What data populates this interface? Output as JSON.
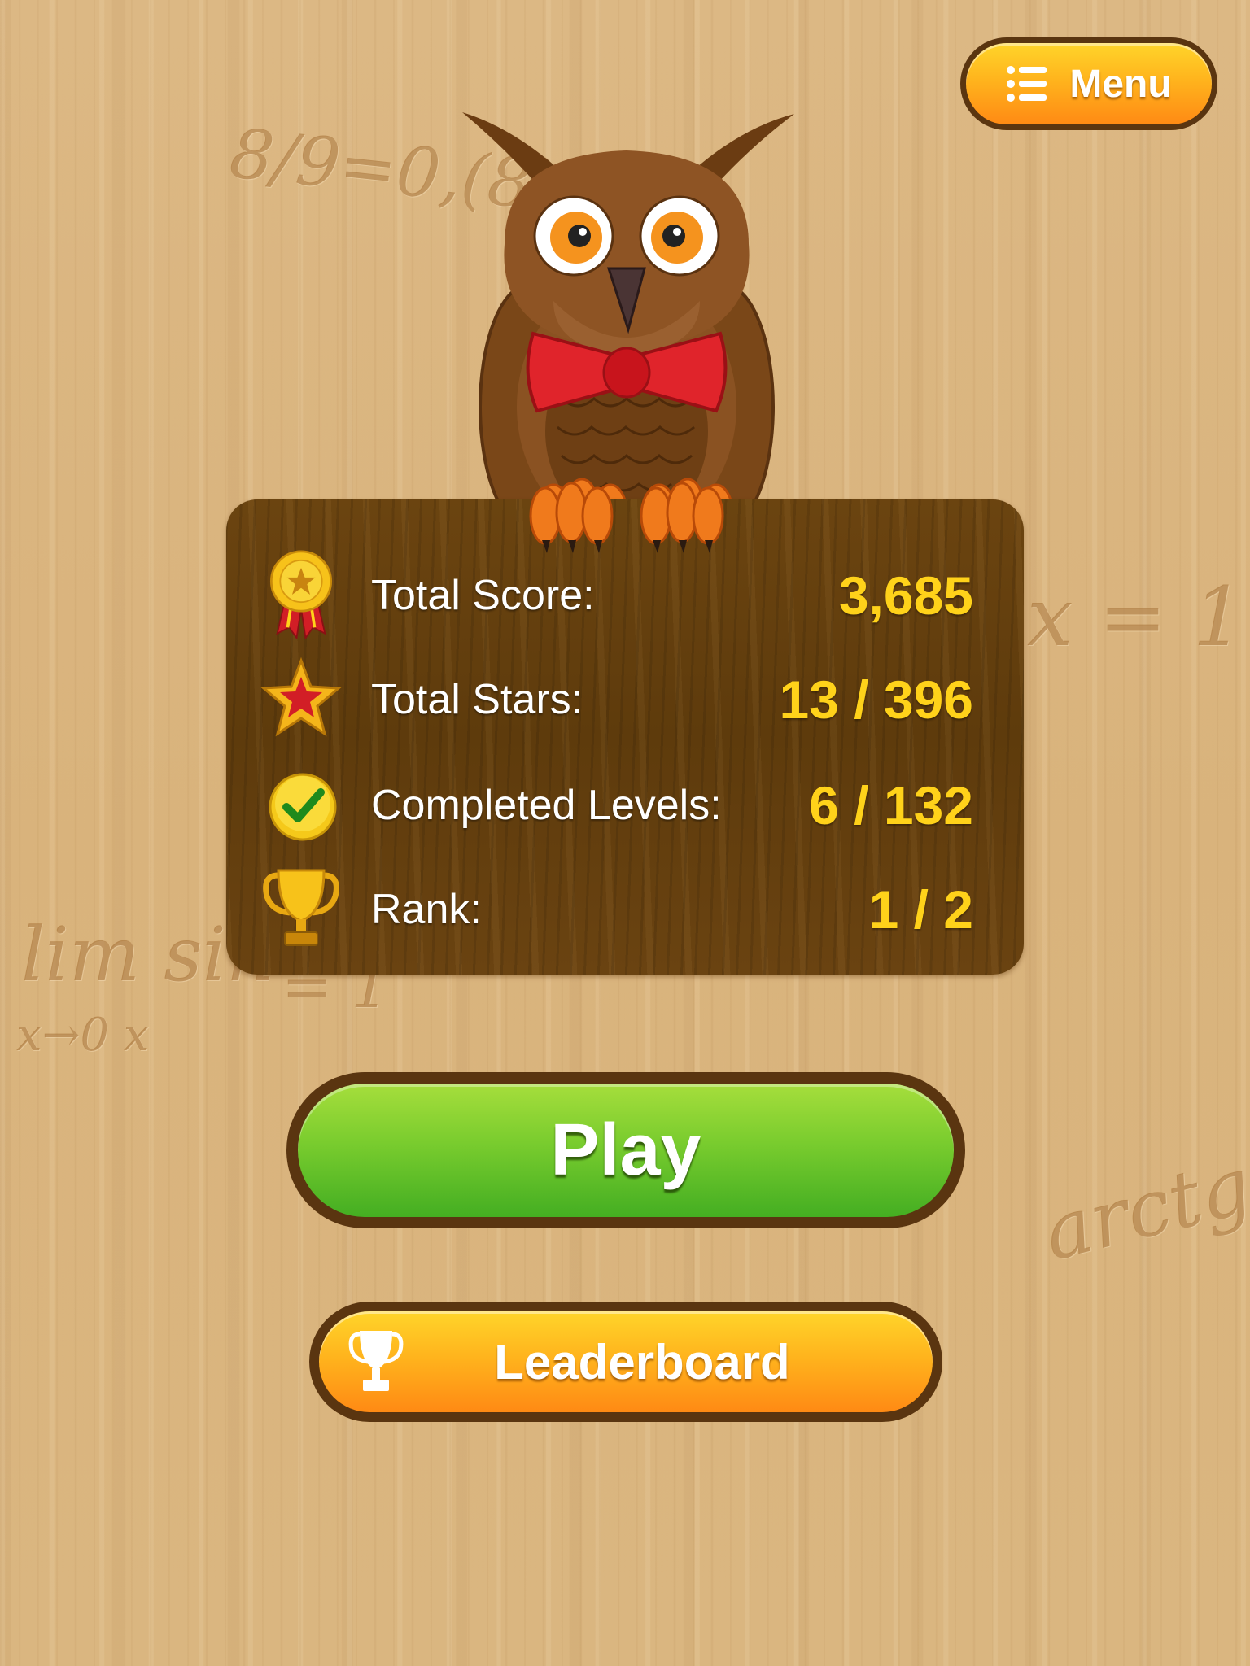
{
  "background": {
    "scribbles": [
      "8/9=0,(8)",
      "x = 1",
      "lim sin",
      "x→0  x",
      "= 1",
      "arctg x"
    ]
  },
  "menu": {
    "label": "Menu",
    "icon": "list-icon"
  },
  "mascot": {
    "icon": "owl-bowtie"
  },
  "stats": {
    "total_score": {
      "label": "Total Score:",
      "value": "3,685",
      "icon": "medal-icon"
    },
    "total_stars": {
      "label": "Total Stars:",
      "value": "13 / 396",
      "icon": "star-icon"
    },
    "completed_levels": {
      "label": "Completed Levels:",
      "value": "6 / 132",
      "icon": "checkmark-icon"
    },
    "rank": {
      "label": "Rank:",
      "value": "1 / 2",
      "icon": "trophy-icon"
    }
  },
  "play": {
    "label": "Play"
  },
  "leaderboard": {
    "label": "Leaderboard",
    "icon": "trophy-icon"
  },
  "colors": {
    "value_yellow": "#ffd21a",
    "play_green": "#5dbf28",
    "orange": "#ffa01a",
    "panel_brown": "#634010",
    "border_brown": "#5a3510"
  }
}
